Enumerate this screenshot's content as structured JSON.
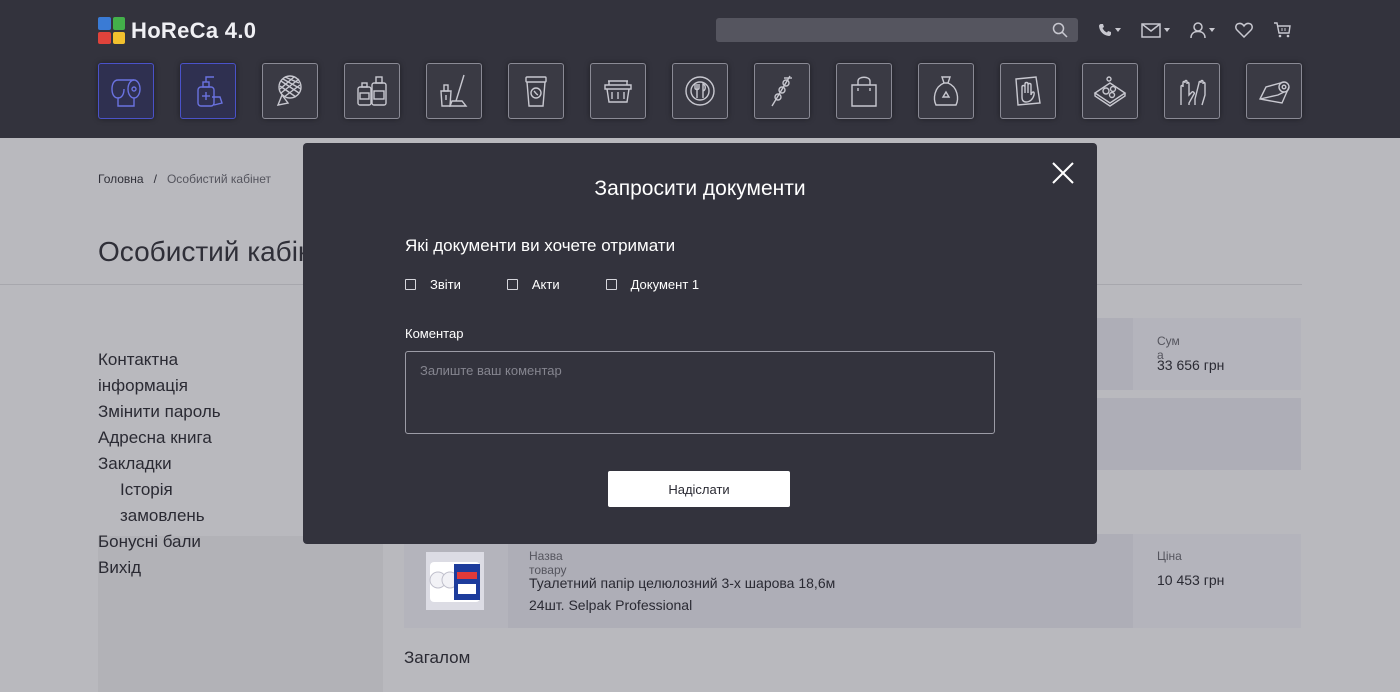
{
  "header": {
    "logo_text": "HoReCa 4.0",
    "search": {
      "placeholder": ""
    },
    "icons": [
      "phone-icon",
      "mail-icon",
      "user-icon",
      "heart-icon",
      "cart-icon"
    ],
    "categories": [
      {
        "icon": "toilet-paper-icon",
        "active": true
      },
      {
        "icon": "sanitizer-icon",
        "active": true
      },
      {
        "icon": "sponge-icon",
        "active": false
      },
      {
        "icon": "cleaning-bottles-icon",
        "active": false
      },
      {
        "icon": "mop-bucket-icon",
        "active": false
      },
      {
        "icon": "coffee-cup-icon",
        "active": false
      },
      {
        "icon": "food-container-icon",
        "active": false
      },
      {
        "icon": "plate-cutlery-icon",
        "active": false
      },
      {
        "icon": "skewer-icon",
        "active": false
      },
      {
        "icon": "shopping-bag-icon",
        "active": false
      },
      {
        "icon": "trash-bag-icon",
        "active": false
      },
      {
        "icon": "cleaning-cloth-icon",
        "active": false
      },
      {
        "icon": "tray-icon",
        "active": false
      },
      {
        "icon": "gloves-icon",
        "active": false
      },
      {
        "icon": "foil-roll-icon",
        "active": false
      }
    ]
  },
  "breadcrumb": {
    "home": "Головна",
    "separator": "/",
    "current": "Особистий кабінет"
  },
  "page": {
    "title": "Особистий кабінет"
  },
  "sidebar": {
    "items": [
      {
        "label": "Контактна інформація"
      },
      {
        "label": "Змінити пароль"
      },
      {
        "label": "Адресна книга"
      },
      {
        "label": "Закладки"
      },
      {
        "label": "Історія замовлень"
      },
      {
        "label": "Бонусні бали"
      },
      {
        "label": "Вихід"
      }
    ]
  },
  "order": {
    "sum_label": "Сума",
    "sum_value": "33 656 грн",
    "product_name_label": "Назва товару",
    "product_name": "Туалетний папір целюлозний 3-х шарова 18,6м 24шт. Selpak Professional",
    "price_label": "Ціна",
    "price_value": "10 453 грн",
    "total_label": "Загалом"
  },
  "modal": {
    "title": "Запросити документи",
    "question": "Які документи ви хочете отримати",
    "options": [
      {
        "label": "Звіти",
        "checked": false
      },
      {
        "label": "Акти",
        "checked": false
      },
      {
        "label": "Документ 1",
        "checked": false
      }
    ],
    "comment_label": "Коментар",
    "comment_placeholder": "Залиште ваш коментар",
    "comment_value": "",
    "submit_label": "Надіслати"
  },
  "colors": {
    "header_bg": "#33333d",
    "modal_bg": "#33333d",
    "active_category_border": "#4a52c9",
    "overlay_page_bg": "#b9b9be"
  }
}
